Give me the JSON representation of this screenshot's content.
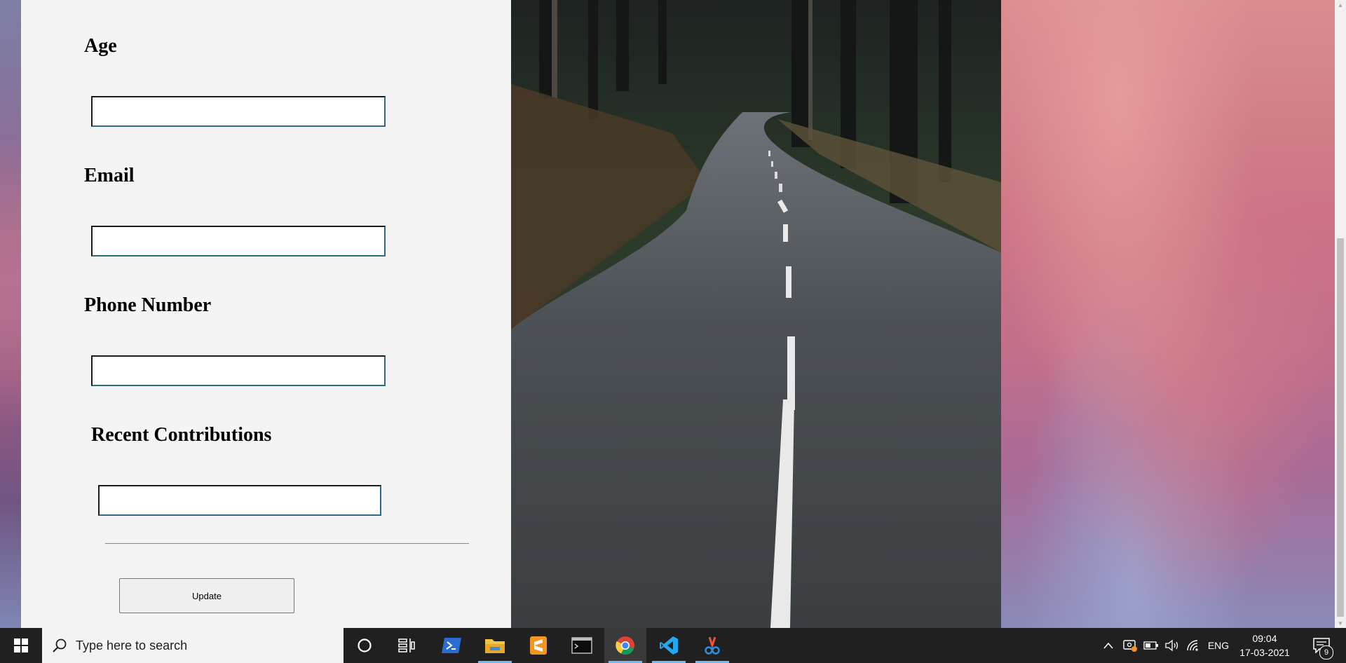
{
  "form": {
    "age_label": "Age",
    "age_value": "",
    "email_label": "Email",
    "email_value": "",
    "phone_label": "Phone Number",
    "phone_value": "",
    "contributions_label": "Recent Contributions",
    "contributions_value": "",
    "update_label": "Update"
  },
  "taskbar": {
    "search_placeholder": "Type here to search",
    "apps": [
      "cortana-icon",
      "task-view-icon",
      "powershell-icon",
      "file-explorer-icon",
      "sublime-text-icon",
      "terminal-icon",
      "chrome-icon",
      "vscode-icon",
      "snipping-tool-icon"
    ],
    "language": "ENG",
    "time": "09:04",
    "date": "17-03-2021",
    "notification_count": "9"
  },
  "colors": {
    "form_background": "#f4f4f4",
    "taskbar": "#202020",
    "active_indicator": "#76b9ed"
  }
}
